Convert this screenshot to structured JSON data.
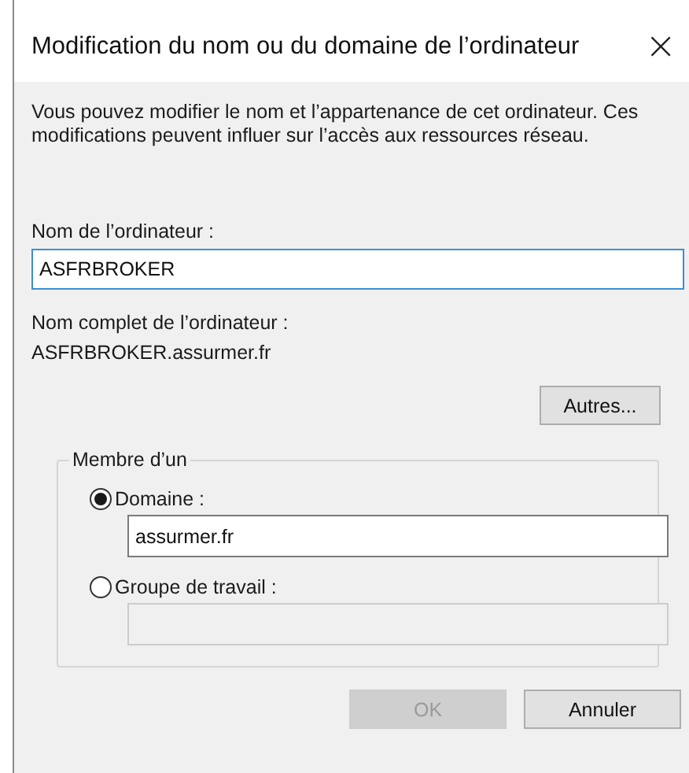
{
  "window": {
    "title": "Modification du nom ou du domaine de l’ordinateur",
    "close": "×"
  },
  "description": "Vous pouvez modifier le nom et l’appartenance de cet ordinateur. Ces modifications peuvent influer sur l’accès aux ressources réseau.",
  "computer_name": {
    "label": "Nom de l’ordinateur :",
    "value": "ASFRBROKER",
    "focused": true
  },
  "full_name": {
    "label": "Nom complet de l’ordinateur :",
    "value": "ASFRBROKER.assurmer.fr"
  },
  "other_button": {
    "label": "Autres...",
    "disabled": false
  },
  "membership": {
    "legend": "Membre d’un",
    "options": [
      {
        "label": "Domaine :",
        "selected": true,
        "value": "assurmer.fr"
      },
      {
        "label": "Groupe de travail :",
        "selected": false
      }
    ]
  },
  "buttons": [
    {
      "label": "OK",
      "disabled": true
    },
    {
      "label": "Annuler",
      "disabled": false
    }
  ]
}
